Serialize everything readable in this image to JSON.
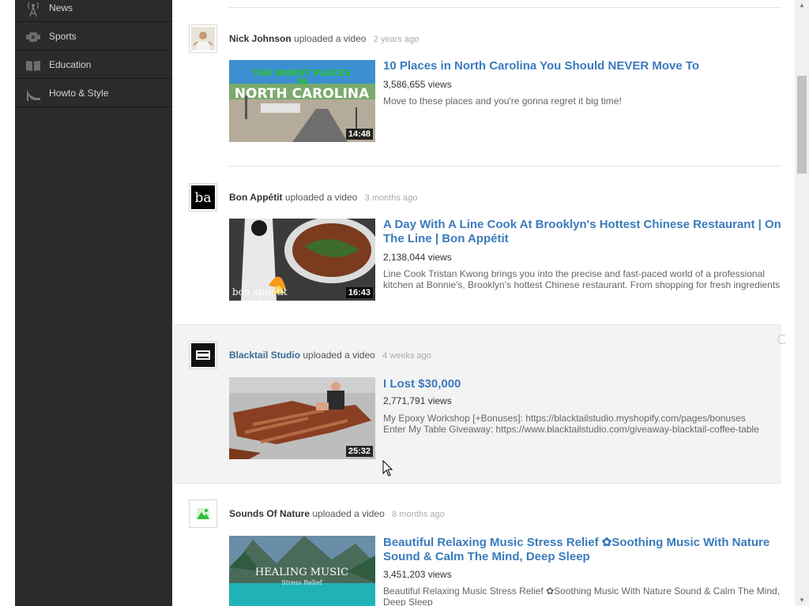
{
  "sidebar": {
    "items": [
      {
        "label": "News",
        "icon": "antenna-icon"
      },
      {
        "label": "Sports",
        "icon": "sports-icon"
      },
      {
        "label": "Education",
        "icon": "book-icon"
      },
      {
        "label": "Howto & Style",
        "icon": "high-heel-icon"
      }
    ]
  },
  "feed": [
    {
      "channel": "Nick Johnson",
      "action": "uploaded a video",
      "ago": "2 years ago",
      "title": "10 Places in North Carolina You Should NEVER Move To",
      "views": "3,586,655 views",
      "description": [
        "Move to these places and you're gonna regret it big time!"
      ],
      "duration": "14:48",
      "thumb_text": "THE WORST PLACES IN NORTH CAROLINA",
      "thumb_text_a": "THE WORST PLACES",
      "thumb_text_b": "IN",
      "thumb_text_c": "NORTH CAROLINA"
    },
    {
      "channel": "Bon Appétit",
      "action": "uploaded a video",
      "ago": "3 months ago",
      "title": "A Day With A Line Cook At Brooklyn's Hottest Chinese Restaurant | On The Line | Bon Appétit",
      "title_a": "A Day With A Line Cook At Brooklyn's Hottest Chinese Restaurant | On",
      "title_b": "The Line | Bon Appétit",
      "views": "2,138,044 views",
      "description": [
        "Line Cook Tristan Kwong brings you into the precise and fast-paced world of a professional",
        "kitchen at Bonnie's, Brooklyn's hottest Chinese restaurant. From shopping for fresh ingredients"
      ],
      "duration": "16:43",
      "avatar_text": "ba",
      "thumb_text": "bon appétit"
    },
    {
      "channel": "Blacktail Studio",
      "action": "uploaded a video",
      "ago": "4 weeks ago",
      "title": "I Lost $30,000",
      "views": "2,771,791 views",
      "description": [
        "My Epoxy Workshop [+Bonuses]: https://blacktailstudio.myshopify.com/pages/bonuses",
        "Enter My Table Giveaway: https://www.blacktailstudio.com/giveaway-blacktail-coffee-table"
      ],
      "duration": "25:32"
    },
    {
      "channel": "Sounds Of Nature",
      "action": "uploaded a video",
      "ago": "8 months ago",
      "title": "Beautiful Relaxing Music Stress Relief ✿Soothing Music With Nature Sound & Calm The Mind, Deep Sleep",
      "title_a": "Beautiful Relaxing Music Stress Relief ✿Soothing Music With Nature",
      "title_b": "Sound & Calm The Mind, Deep Sleep",
      "views": "3,451,203 views",
      "description": [
        "Beautiful Relaxing Music Stress Relief ✿Soothing Music With Nature Sound & Calm The Mind,",
        "Deep Sleep"
      ],
      "thumb_text": "HEALING MUSIC",
      "thumb_sub": "Stress Relief"
    }
  ],
  "colors": {
    "link": "#3a7bbd",
    "sidebar_bg": "#2b2b2b",
    "highlight_bg": "#f3f3f3"
  }
}
